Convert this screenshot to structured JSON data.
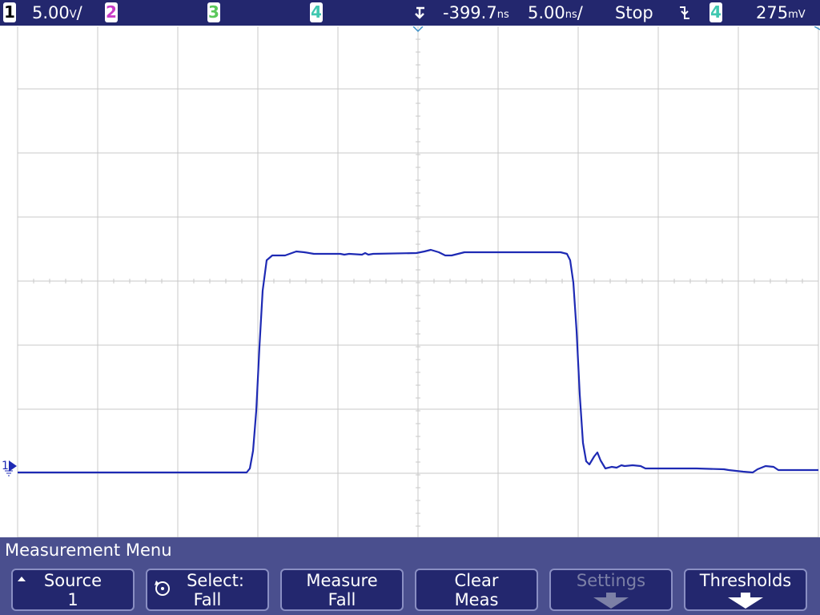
{
  "status_bar": {
    "ch1": {
      "number": "1",
      "scale": "5.00",
      "unit": "V",
      "suffix": "/",
      "color": "#ffffff"
    },
    "ch2": {
      "number": "2",
      "color": "#c83cc8"
    },
    "ch3": {
      "number": "3",
      "color": "#5ac85a"
    },
    "ch4": {
      "number": "4",
      "color": "#40c8b0"
    },
    "delay": {
      "value": "-399.7",
      "unit": "ns"
    },
    "timebase": {
      "value": "5.00",
      "unit": "ns",
      "suffix": "/"
    },
    "run_state": "Stop",
    "trigger": {
      "slope_symbol": "⨏",
      "source": "4",
      "level": "275",
      "level_unit": "mV"
    }
  },
  "waveform": {
    "channel": "1",
    "color": "#1e2ab4",
    "ground_marker": "1"
  },
  "menu": {
    "title": "Measurement Menu",
    "softkeys": [
      {
        "line1": "Source",
        "line2": "1",
        "indicator": "up-arrow",
        "enabled": true
      },
      {
        "line1": "Select:",
        "line2": "Fall",
        "indicator": "rotate-knob",
        "enabled": true
      },
      {
        "line1": "Measure",
        "line2": "Fall",
        "indicator": "",
        "enabled": true
      },
      {
        "line1": "Clear",
        "line2": "Meas",
        "indicator": "",
        "enabled": true
      },
      {
        "line1": "Settings",
        "line2": "",
        "indicator": "down-arrow",
        "enabled": false
      },
      {
        "line1": "Thresholds",
        "line2": "",
        "indicator": "down-arrow",
        "enabled": true
      }
    ]
  },
  "colors": {
    "status_bg": "#23276e",
    "menu_bg": "#4a4f8e",
    "grid": "#c8c8c8",
    "screen_bg": "#ffffff"
  }
}
